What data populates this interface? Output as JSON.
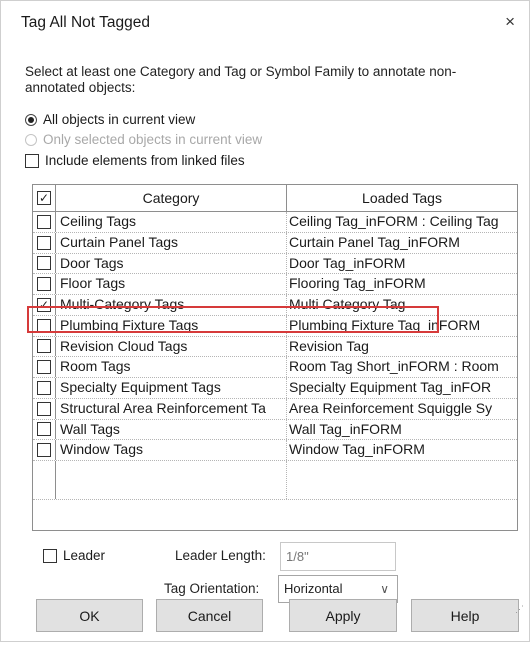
{
  "window": {
    "title": "Tag All Not Tagged",
    "close_glyph": "×"
  },
  "instructions": "Select at least one Category and Tag or Symbol Family to annotate non-annotated objects:",
  "scope": {
    "all_objects_label": "All objects in current view",
    "all_objects_selected": true,
    "only_selected_label": "Only selected objects in current view",
    "only_selected_enabled": false,
    "include_linked_label": "Include elements from linked files",
    "include_linked_checked": false
  },
  "table": {
    "columns": [
      "Category",
      "Loaded Tags"
    ],
    "header_checked": true,
    "rows": [
      {
        "category": "Ceiling Tags",
        "tag": "Ceiling Tag_inFORM : Ceiling Tag",
        "checked": false
      },
      {
        "category": "Curtain Panel Tags",
        "tag": "Curtain Panel Tag_inFORM",
        "checked": false
      },
      {
        "category": "Door Tags",
        "tag": "Door Tag_inFORM",
        "checked": false
      },
      {
        "category": "Floor Tags",
        "tag": "Flooring Tag_inFORM",
        "checked": false
      },
      {
        "category": "Multi-Category Tags",
        "tag": "Multi Category Tag",
        "checked": true,
        "highlighted": true
      },
      {
        "category": "Plumbing Fixture Tags",
        "tag": "Plumbing Fixture Tag_inFORM",
        "checked": false
      },
      {
        "category": "Revision Cloud Tags",
        "tag": "Revision Tag",
        "checked": false
      },
      {
        "category": "Room Tags",
        "tag": "Room Tag Short_inFORM : Room",
        "checked": false
      },
      {
        "category": "Specialty Equipment Tags",
        "tag": "Specialty Equipment Tag_inFOR",
        "checked": false
      },
      {
        "category": "Structural Area Reinforcement Ta",
        "tag": "Area Reinforcement Squiggle Sy",
        "checked": false
      },
      {
        "category": "Wall Tags",
        "tag": "Wall Tag_inFORM",
        "checked": false
      },
      {
        "category": "Window Tags",
        "tag": "Window Tag_inFORM",
        "checked": false
      }
    ]
  },
  "leader": {
    "label": "Leader",
    "checked": false,
    "length_label": "Leader Length:",
    "length_value": "1/8\""
  },
  "orientation": {
    "label": "Tag Orientation:",
    "value": "Horizontal"
  },
  "buttons": {
    "ok": "OK",
    "cancel": "Cancel",
    "apply": "Apply",
    "help": "Help"
  },
  "colors": {
    "highlight_border": "#d63a3a",
    "button_face": "#e1e1e1"
  }
}
